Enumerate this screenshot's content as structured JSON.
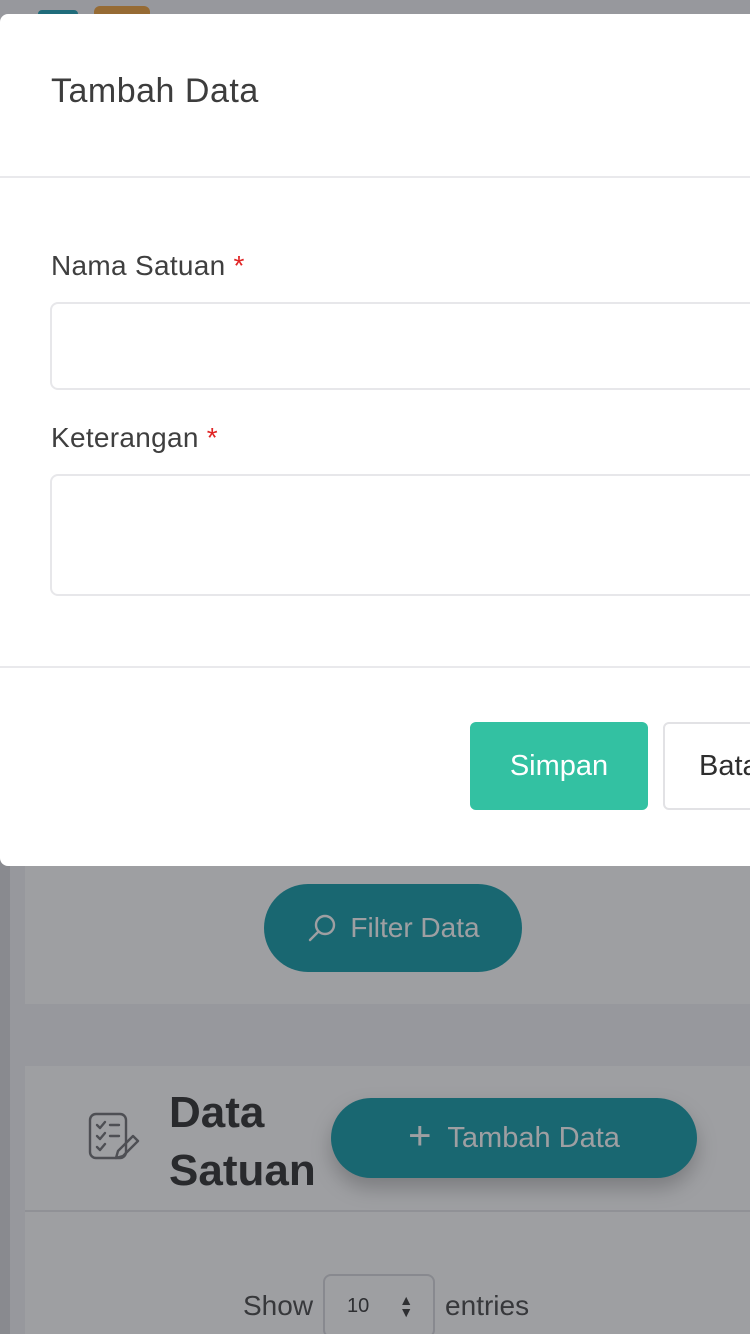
{
  "modal": {
    "title": "Tambah Data",
    "fields": [
      {
        "label": "Nama Satuan",
        "required_mark": "*",
        "value": ""
      },
      {
        "label": "Keterangan",
        "required_mark": "*",
        "value": ""
      }
    ],
    "buttons": {
      "save": "Simpan",
      "cancel": "Batal"
    }
  },
  "background": {
    "filter_button": "Filter Data",
    "data_title": "Data Satuan",
    "add_button": "Tambah Data",
    "entries": {
      "show": "Show",
      "value": "10",
      "entries": "entries"
    }
  },
  "colors": {
    "save_button": "#33c1a2",
    "primary_button": "#0e9aa7",
    "required_mark": "#e02424"
  }
}
